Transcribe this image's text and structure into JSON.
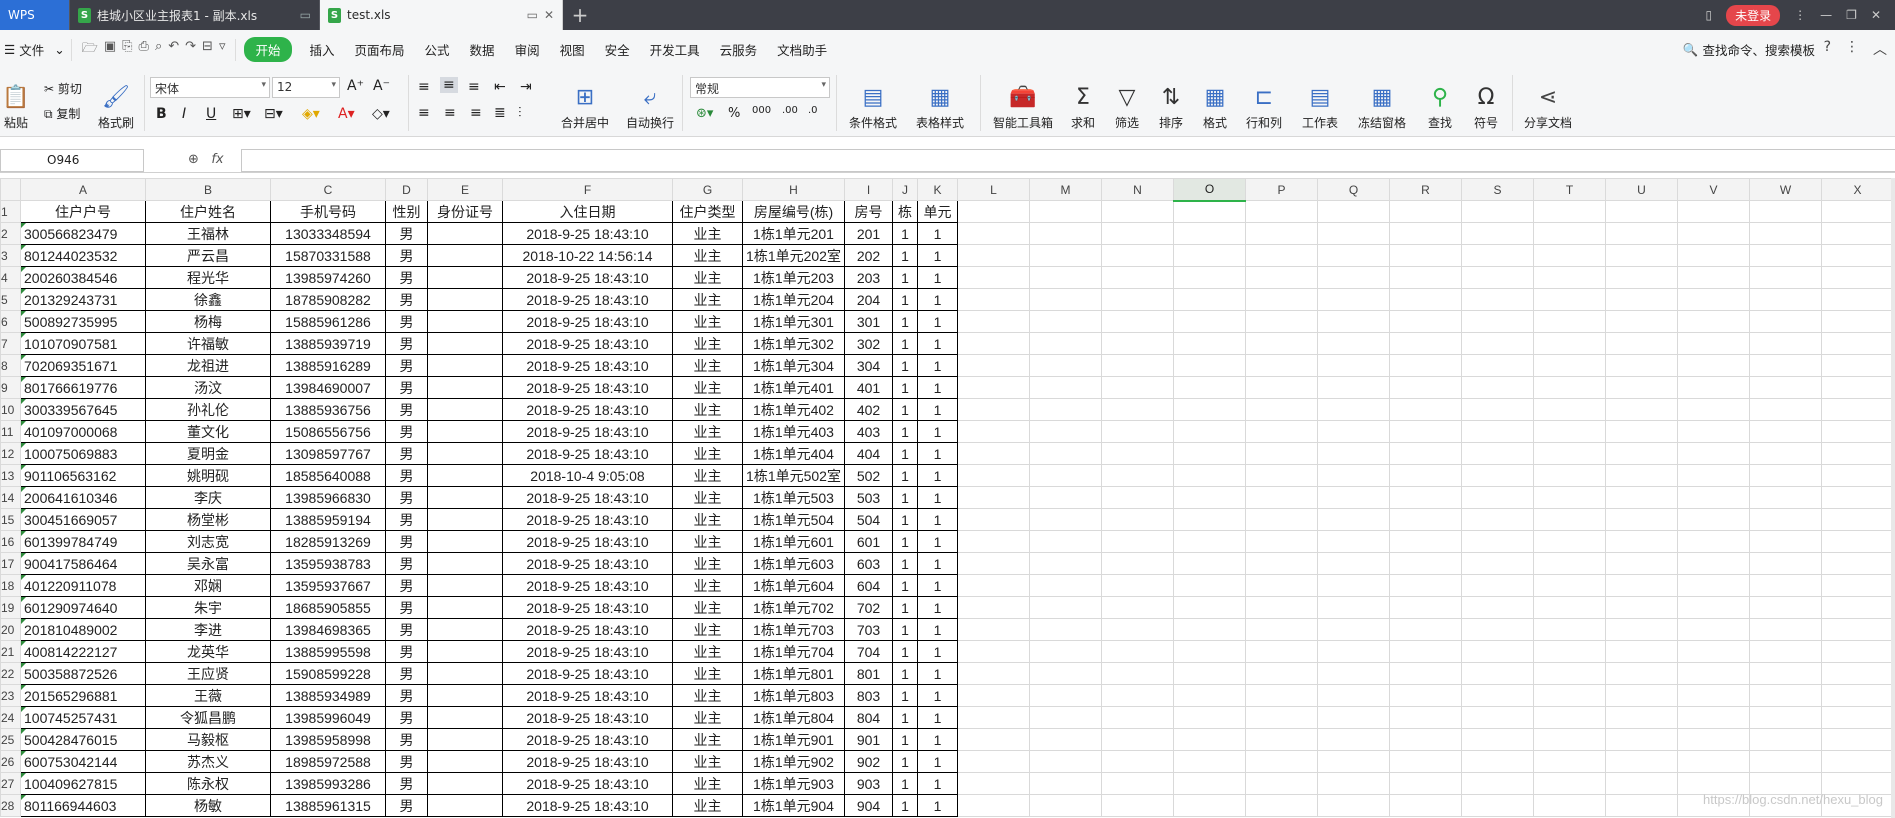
{
  "tabs": {
    "wps": "WPS",
    "file1": "桂城小区业主报表1 - 副本.xls",
    "file2": "test.xls"
  },
  "titlebar": {
    "login": "未登录"
  },
  "menu": {
    "file": "文件",
    "items": [
      "开始",
      "插入",
      "页面布局",
      "公式",
      "数据",
      "审阅",
      "视图",
      "安全",
      "开发工具",
      "云服务",
      "文档助手"
    ],
    "search": "查找命令、搜索模板"
  },
  "ribbon": {
    "paste": "粘贴",
    "cut": "剪切",
    "copy": "复制",
    "format_painter": "格式刷",
    "font": "宋体",
    "font_size": "12",
    "number_format": "常规",
    "merge_center": "合并居中",
    "wrap": "自动换行",
    "cond_format": "条件格式",
    "table_style": "表格样式",
    "smart_toolbox": "智能工具箱",
    "sum": "求和",
    "filter": "筛选",
    "sort": "排序",
    "format": "格式",
    "rows_cols": "行和列",
    "worksheet": "工作表",
    "freeze": "冻结窗格",
    "find": "查找",
    "symbol": "符号",
    "share": "分享文档"
  },
  "formula_bar": {
    "cell_ref": "O946",
    "fx": "fx"
  },
  "sheet": {
    "col_letters": [
      "A",
      "B",
      "C",
      "D",
      "E",
      "F",
      "G",
      "H",
      "I",
      "J",
      "K",
      "L",
      "M",
      "N",
      "O",
      "P",
      "Q",
      "R",
      "S",
      "T",
      "U",
      "V",
      "W",
      "X"
    ],
    "selected_col": "O",
    "row_numbers": [
      "1",
      "2",
      "3",
      "4",
      "5",
      "6",
      "7",
      "8",
      "9",
      "10",
      "11",
      "12",
      "13",
      "14",
      "15",
      "16",
      "17",
      "18",
      "19",
      "20",
      "21",
      "22",
      "23",
      "24",
      "25",
      "26",
      "27",
      "28"
    ],
    "headers": [
      "住户户号",
      "住户姓名",
      "手机号码",
      "性别",
      "身份证号",
      "入住日期",
      "住户类型",
      "房屋编号(栋)",
      "房号",
      "栋",
      "单元"
    ],
    "rows": [
      [
        "300566823479",
        "王福林",
        "13033348594",
        "男",
        "",
        "2018-9-25 18:43:10",
        "业主",
        "1栋1单元201",
        "201",
        "1",
        "1"
      ],
      [
        "801244023532",
        "严云昌",
        "15870331588",
        "男",
        "",
        "2018-10-22 14:56:14",
        "业主",
        "1栋1单元202室",
        "202",
        "1",
        "1"
      ],
      [
        "200260384546",
        "程光华",
        "13985974260",
        "男",
        "",
        "2018-9-25 18:43:10",
        "业主",
        "1栋1单元203",
        "203",
        "1",
        "1"
      ],
      [
        "201329243731",
        "徐鑫",
        "18785908282",
        "男",
        "",
        "2018-9-25 18:43:10",
        "业主",
        "1栋1单元204",
        "204",
        "1",
        "1"
      ],
      [
        "500892735995",
        "杨梅",
        "15885961286",
        "男",
        "",
        "2018-9-25 18:43:10",
        "业主",
        "1栋1单元301",
        "301",
        "1",
        "1"
      ],
      [
        "101070907581",
        "许福敏",
        "13885939719",
        "男",
        "",
        "2018-9-25 18:43:10",
        "业主",
        "1栋1单元302",
        "302",
        "1",
        "1"
      ],
      [
        "702069351671",
        "龙祖进",
        "13885916289",
        "男",
        "",
        "2018-9-25 18:43:10",
        "业主",
        "1栋1单元304",
        "304",
        "1",
        "1"
      ],
      [
        "801766619776",
        "汤汶",
        "13984690007",
        "男",
        "",
        "2018-9-25 18:43:10",
        "业主",
        "1栋1单元401",
        "401",
        "1",
        "1"
      ],
      [
        "300339567645",
        "孙礼伦",
        "13885936756",
        "男",
        "",
        "2018-9-25 18:43:10",
        "业主",
        "1栋1单元402",
        "402",
        "1",
        "1"
      ],
      [
        "401097000068",
        "董文化",
        "15086556756",
        "男",
        "",
        "2018-9-25 18:43:10",
        "业主",
        "1栋1单元403",
        "403",
        "1",
        "1"
      ],
      [
        "100075069883",
        "夏明金",
        "13098597767",
        "男",
        "",
        "2018-9-25 18:43:10",
        "业主",
        "1栋1单元404",
        "404",
        "1",
        "1"
      ],
      [
        "901106563162",
        "姚明砚",
        "18585640088",
        "男",
        "",
        "2018-10-4 9:05:08",
        "业主",
        "1栋1单元502室",
        "502",
        "1",
        "1"
      ],
      [
        "200641610346",
        "李庆",
        "13985966830",
        "男",
        "",
        "2018-9-25 18:43:10",
        "业主",
        "1栋1单元503",
        "503",
        "1",
        "1"
      ],
      [
        "300451669057",
        "杨堂彬",
        "13885959194",
        "男",
        "",
        "2018-9-25 18:43:10",
        "业主",
        "1栋1单元504",
        "504",
        "1",
        "1"
      ],
      [
        "601399784749",
        "刘志宽",
        "18285913269",
        "男",
        "",
        "2018-9-25 18:43:10",
        "业主",
        "1栋1单元601",
        "601",
        "1",
        "1"
      ],
      [
        "900417586464",
        "吴永富",
        "13595938783",
        "男",
        "",
        "2018-9-25 18:43:10",
        "业主",
        "1栋1单元603",
        "603",
        "1",
        "1"
      ],
      [
        "401220911078",
        "邓娴",
        "13595937667",
        "男",
        "",
        "2018-9-25 18:43:10",
        "业主",
        "1栋1单元604",
        "604",
        "1",
        "1"
      ],
      [
        "601290974640",
        "朱宇",
        "18685905855",
        "男",
        "",
        "2018-9-25 18:43:10",
        "业主",
        "1栋1单元702",
        "702",
        "1",
        "1"
      ],
      [
        "201810489002",
        "李进",
        "13984698365",
        "男",
        "",
        "2018-9-25 18:43:10",
        "业主",
        "1栋1单元703",
        "703",
        "1",
        "1"
      ],
      [
        "400814222127",
        "龙英华",
        "13885995598",
        "男",
        "",
        "2018-9-25 18:43:10",
        "业主",
        "1栋1单元704",
        "704",
        "1",
        "1"
      ],
      [
        "500358872526",
        "王应贤",
        "15908599228",
        "男",
        "",
        "2018-9-25 18:43:10",
        "业主",
        "1栋1单元801",
        "801",
        "1",
        "1"
      ],
      [
        "201565296881",
        "王薇",
        "13885934989",
        "男",
        "",
        "2018-9-25 18:43:10",
        "业主",
        "1栋1单元803",
        "803",
        "1",
        "1"
      ],
      [
        "100745257431",
        "令狐昌鹏",
        "13985996049",
        "男",
        "",
        "2018-9-25 18:43:10",
        "业主",
        "1栋1单元804",
        "804",
        "1",
        "1"
      ],
      [
        "500428476015",
        "马毅枢",
        "13985958998",
        "男",
        "",
        "2018-9-25 18:43:10",
        "业主",
        "1栋1单元901",
        "901",
        "1",
        "1"
      ],
      [
        "600753042144",
        "苏杰义",
        "18985972588",
        "男",
        "",
        "2018-9-25 18:43:10",
        "业主",
        "1栋1单元902",
        "902",
        "1",
        "1"
      ],
      [
        "100409627815",
        "陈永权",
        "13985993286",
        "男",
        "",
        "2018-9-25 18:43:10",
        "业主",
        "1栋1单元903",
        "903",
        "1",
        "1"
      ],
      [
        "801166944603",
        "杨敏",
        "13885961315",
        "男",
        "",
        "2018-9-25 18:43:10",
        "业主",
        "1栋1单元904",
        "904",
        "1",
        "1"
      ]
    ]
  },
  "watermark": "https://blog.csdn.net/hexu_blog"
}
